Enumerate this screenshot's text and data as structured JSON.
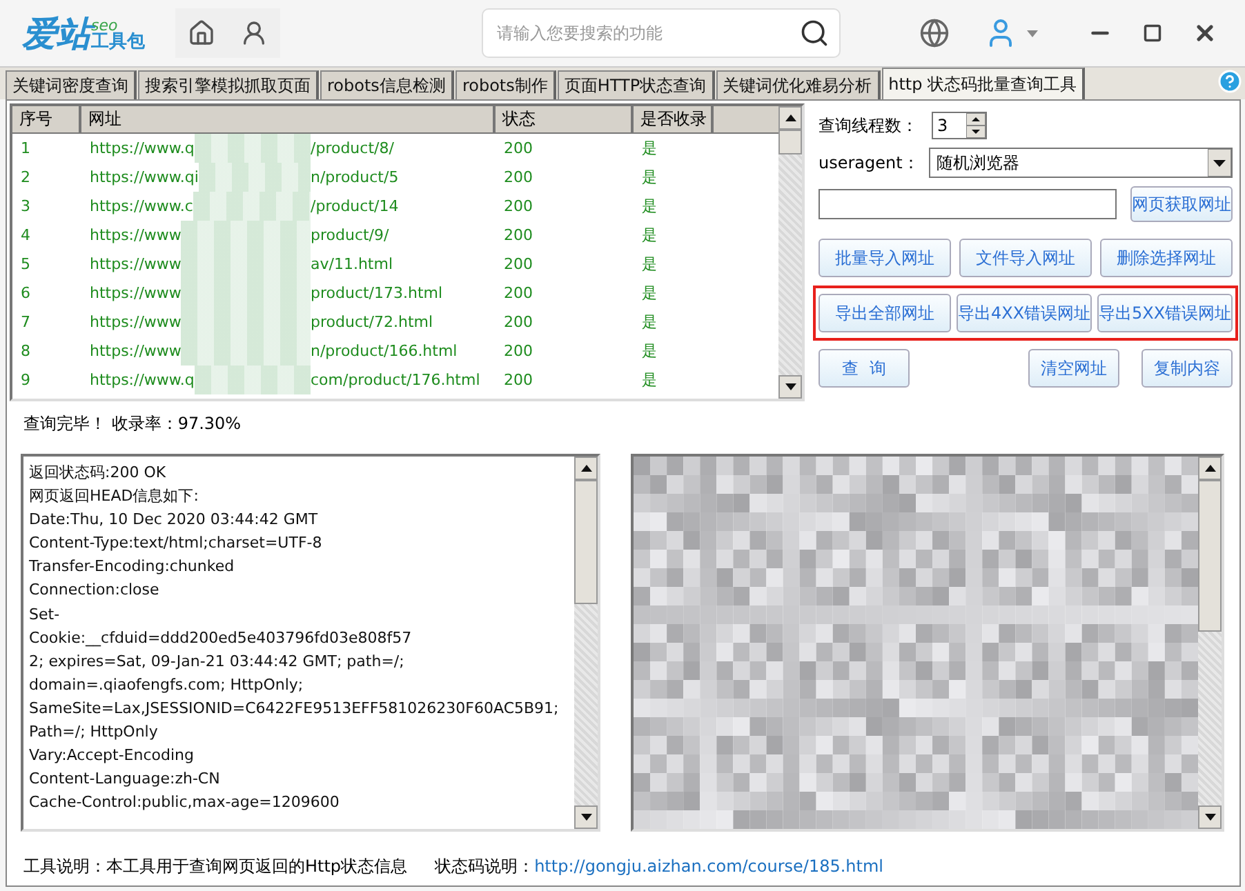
{
  "app": {
    "logo": "爱站",
    "logo_sup": "seo",
    "logo_sub": "工具包",
    "search": {
      "placeholder": "请输入您要搜索的功能"
    }
  },
  "tabs": [
    {
      "label": "关键词密度查询",
      "selected": false
    },
    {
      "label": "搜索引擎模拟抓取页面",
      "selected": false
    },
    {
      "label": "robots信息检测",
      "selected": false
    },
    {
      "label": "robots制作",
      "selected": false
    },
    {
      "label": "页面HTTP状态查询",
      "selected": false
    },
    {
      "label": "关键词优化难易分析",
      "selected": false
    },
    {
      "label": "http 状态码批量查询工具",
      "selected": true
    }
  ],
  "table": {
    "columns": [
      "序号",
      "网址",
      "状态",
      "是否收录"
    ],
    "rows": [
      {
        "index": "1",
        "url_start": "https://www.q",
        "url_end": "/product/8/",
        "status": "200",
        "indexed": "是"
      },
      {
        "index": "2",
        "url_start": "https://www.qi",
        "url_end": "n/product/5",
        "status": "200",
        "indexed": "是"
      },
      {
        "index": "3",
        "url_start": "https://www.c",
        "url_end": "/product/14",
        "status": "200",
        "indexed": "是"
      },
      {
        "index": "4",
        "url_start": "https://www",
        "url_end": "product/9/",
        "status": "200",
        "indexed": "是"
      },
      {
        "index": "5",
        "url_start": "https://www",
        "url_end": "av/11.html",
        "status": "200",
        "indexed": "是"
      },
      {
        "index": "6",
        "url_start": "https://www",
        "url_end": "product/173.html",
        "status": "200",
        "indexed": "是"
      },
      {
        "index": "7",
        "url_start": "https://www",
        "url_end": "product/72.html",
        "status": "200",
        "indexed": "是"
      },
      {
        "index": "8",
        "url_start": "https://www",
        "url_end": "n/product/166.html",
        "status": "200",
        "indexed": "是"
      },
      {
        "index": "9",
        "url_start": "https://www.q",
        "url_end": "com/product/176.html",
        "status": "200",
        "indexed": "是"
      }
    ]
  },
  "controls": {
    "threads_label": "查询线程数：",
    "threads": "3",
    "ua_label": "useragent：",
    "ua": "随机浏览器",
    "fetch_button": "网页获取网址",
    "buttons": [
      "批量导入网址",
      "文件导入网址",
      "删除选择网址"
    ],
    "export_buttons": [
      "导出全部网址",
      "导出4XX错误网址",
      "导出5XX错误网址"
    ],
    "query_button": "查  询",
    "clear_button": "清空网址",
    "copy_button": "复制内容"
  },
  "status": "查询完毕！ 收录率：97.30%",
  "response": {
    "lines": [
      "返回状态码:200  OK",
      "网页返回HEAD信息如下:",
      "Date:Thu, 10 Dec 2020 03:44:42 GMT",
      "Content-Type:text/html;charset=UTF-8",
      "Transfer-Encoding:chunked",
      "Connection:close",
      "Set-",
      "Cookie:__cfduid=ddd200ed5e403796fd03e808f57",
      "2; expires=Sat, 09-Jan-21 03:44:42 GMT; path=/;",
      "domain=.qiaofengfs.com; HttpOnly;",
      "SameSite=Lax,JSESSIONID=C6422FE9513EFF581026230F60AC5B91;",
      "Path=/; HttpOnly",
      "Vary:Accept-Encoding",
      "Content-Language:zh-CN",
      "Cache-Control:public,max-age=1209600"
    ]
  },
  "footer": {
    "note": "工具说明：本工具用于查询网页返回的Http状态信息",
    "link_label": "状态码说明：",
    "link": "http://gongju.aizhan.com/course/185.html"
  }
}
